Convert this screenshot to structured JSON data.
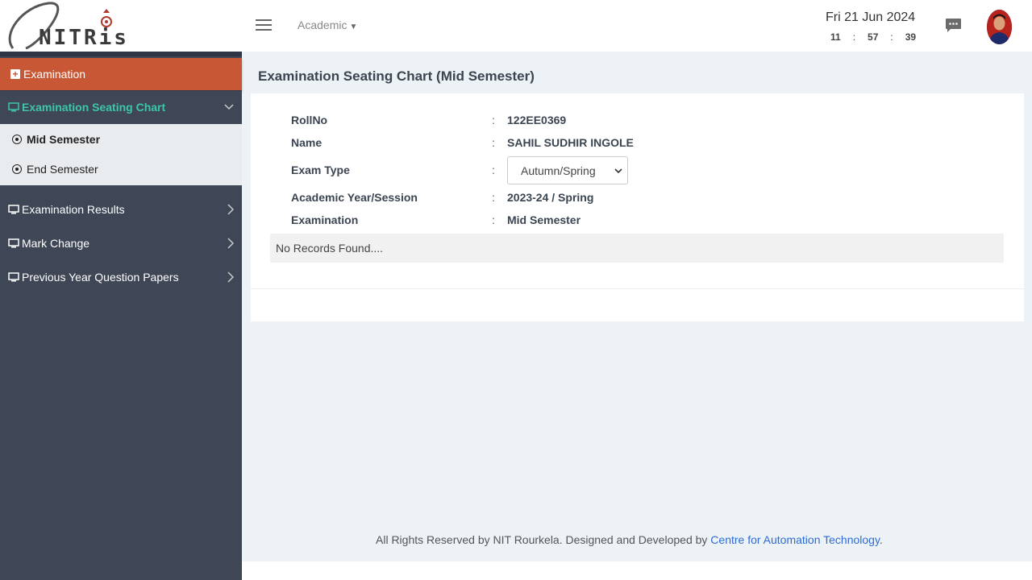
{
  "header": {
    "logo_text": "NITRis",
    "nav_menu": "Academic",
    "date": "Fri 21 Jun 2024",
    "clock": {
      "hours": "11",
      "minutes": "57",
      "seconds": "39",
      "separator": ":"
    }
  },
  "sidebar": {
    "section": "Examination",
    "items": [
      {
        "label": "Examination Seating Chart",
        "expanded": true
      },
      {
        "label": "Examination Results"
      },
      {
        "label": "Mark Change"
      },
      {
        "label": "Previous Year Question Papers"
      }
    ],
    "submenu": [
      {
        "label": "Mid Semester",
        "selected": true
      },
      {
        "label": "End Semester"
      }
    ]
  },
  "main": {
    "title": "Examination Seating Chart (Mid Semester)",
    "fields": {
      "roll_label": "RollNo",
      "roll_value": "122EE0369",
      "name_label": "Name",
      "name_value": "SAHIL SUDHIR INGOLE",
      "exam_type_label": "Exam Type",
      "exam_type_value": "Autumn/Spring",
      "session_label": "Academic Year/Session",
      "session_value": "2023-24 / Spring",
      "exam_label": "Examination",
      "exam_value": "Mid Semester"
    },
    "colon": ":",
    "no_records": "No Records Found...."
  },
  "footer": {
    "text": "All Rights Reserved by NIT Rourkela. Designed and Developed by ",
    "link": "Centre for Automation Technology",
    "suffix": "."
  },
  "colors": {
    "accent": "#c85835",
    "sidebar": "#3f4656",
    "active": "#3cc7a8",
    "link": "#2c6bd6"
  }
}
